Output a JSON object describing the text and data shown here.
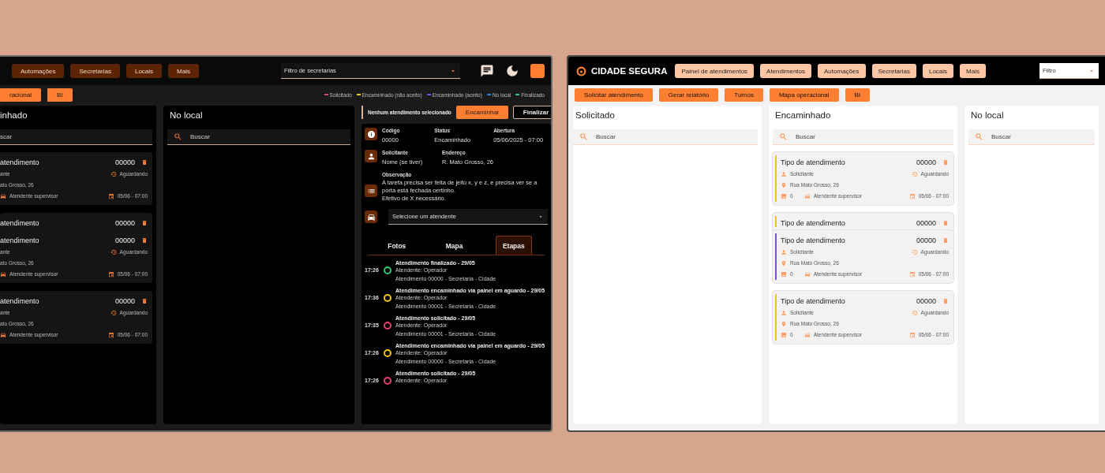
{
  "windows": [
    {
      "kind": "dark",
      "nav": [
        "Automações",
        "Secretarias",
        "Locais",
        "Mais"
      ],
      "filter": {
        "placeholder": "Filtro de secretarias"
      },
      "actions": [
        "racional",
        "BI"
      ],
      "legend": [
        {
          "label": "Solicitado",
          "color": "#e8436e"
        },
        {
          "label": "Encaminhado (não aceito)",
          "color": "#f5c518"
        },
        {
          "label": "Encaminhado (aceito)",
          "color": "#7b4cf0"
        },
        {
          "label": "No local",
          "color": "#1e88e5"
        },
        {
          "label": "Finalizado",
          "color": "#2ecc71"
        }
      ],
      "columns": [
        {
          "title": "inhado",
          "clipped": true,
          "search": {
            "placeholder": "scar"
          },
          "cards": [
            {
              "kind": "full",
              "title": "atendimento",
              "code": "00000",
              "requester": "ante",
              "status": "Aguardando",
              "address": "ato Grosso, 26",
              "attendant": "Atendente supervisor",
              "date": "05/06 - 07:00"
            },
            {
              "kind": "collapsed",
              "title": "atendimento",
              "code": "00000"
            },
            {
              "kind": "full",
              "title": "atendimento",
              "code": "00000",
              "requester": "ante",
              "status": "Aguardando",
              "address": "ato Grosso, 26",
              "attendant": "Atendente supervisor",
              "date": "05/06 - 07:00"
            },
            {
              "kind": "full",
              "title": "atendimento",
              "code": "00000",
              "requester": "ante",
              "status": "Aguardando",
              "address": "ato Grosso, 26",
              "attendant": "Atendente supervisor",
              "date": "05/06 - 07:00"
            }
          ]
        },
        {
          "title": "No local",
          "search": {
            "placeholder": "Buscar"
          }
        }
      ],
      "detail": {
        "notice": "Nenhum atendimento selecionado",
        "buttons": [
          {
            "label": "Encaminhar",
            "kind": "primary"
          },
          {
            "label": "Finalizar",
            "kind": "outline"
          }
        ],
        "summary": [
          {
            "label": "Código",
            "value": "00000"
          },
          {
            "label": "Status",
            "value": "Encaminhado"
          },
          {
            "label": "Abertura",
            "value": "05/06/2025 - 07:00"
          }
        ],
        "requester": [
          {
            "label": "Solicitante",
            "value": "Nome (se tiver)"
          },
          {
            "label": "Endereço",
            "value": "R. Mato Grosso, 26"
          }
        ],
        "observation": {
          "label": "Observação",
          "lines": [
            "A tarefa precisa ser feita de jeito x, y e z, e precisa ver se a porta está fechada certinho.",
            "Efetivo de X necessário."
          ]
        },
        "attendant_select": {
          "placeholder": "Selecione um atendente"
        },
        "tabs": [
          {
            "label": "Fotos",
            "selected": false
          },
          {
            "label": "Mapa",
            "selected": false
          },
          {
            "label": "Etapas",
            "selected": true
          }
        ],
        "timeline": [
          {
            "time": "17:26",
            "color": "#2ecc71",
            "title": "Atendimento finalizado - 29/05",
            "lines": [
              "Atendente: Operador",
              "Atendimento 00000 - Secretaria - Cidade"
            ]
          },
          {
            "time": "17:36",
            "color": "#f5c518",
            "title": "Atendimento encaminhado via painel em aguardo - 29/05",
            "lines": [
              "Atendente: Operador",
              "Atendimento 00001 - Secretaria - Cidade"
            ]
          },
          {
            "time": "17:35",
            "color": "#e8436e",
            "title": "Atendimento solicitado - 29/05",
            "lines": [
              "Atendente: Operador",
              "Atendimento 00001 - Secretaria - Cidade"
            ]
          },
          {
            "time": "17:26",
            "color": "#f5c518",
            "title": "Atendimento encaminhado via painel em aguardo - 29/05",
            "lines": [
              "Atendente: Operador",
              "Atendimento 00000 - Secretaria - Cidade"
            ]
          },
          {
            "time": "17:26",
            "color": "#e8436e",
            "title": "Atendimento solicitado - 29/05",
            "lines": [
              "Atendente: Operador"
            ]
          }
        ]
      }
    },
    {
      "kind": "light",
      "brand": "CIDADE SEGURA",
      "nav": [
        "Painel de atendimentos",
        "Atendimentos",
        "Automações",
        "Secretarias",
        "Locais",
        "Mais"
      ],
      "filter": {
        "placeholder": "Filtro"
      },
      "actions": [
        "Solicitar atendimento",
        "Gerar relatório",
        "Turnos",
        "Mapa operacional",
        "BI"
      ],
      "columns": [
        {
          "title": "Solicitado",
          "search": {
            "placeholder": "Buscar"
          }
        },
        {
          "title": "Encaminhado",
          "search": {
            "placeholder": "Buscar"
          },
          "cards": [
            {
              "kind": "full",
              "color": "#f5c518",
              "title": "Tipo de atendimento",
              "code": "00000",
              "requester": "Solicitante",
              "status": "Aguardando",
              "address": "Rua Mato Grosso, 26",
              "photos": "0",
              "attendant": "Atendente supervisor",
              "date": "05/06 - 07:00"
            },
            {
              "kind": "collapsed",
              "color": "#f5c518",
              "title": "Tipo de atendimento",
              "code": "00000"
            },
            {
              "kind": "full",
              "color": "#7b4cf0",
              "title": "Tipo de atendimento",
              "code": "00000",
              "requester": "Solicitante",
              "status": "Aguardando",
              "address": "Rua Mato Grosso, 26",
              "photos": "0",
              "attendant": "Atendente supervisor",
              "date": "05/06 - 07:00"
            },
            {
              "kind": "full",
              "color": "#f5c518",
              "title": "Tipo de atendimento",
              "code": "00000",
              "requester": "Solicitante",
              "status": "Aguardando",
              "address": "Rua Mato Grosso, 26",
              "photos": "0",
              "attendant": "Atendente supervisor",
              "date": "05/06 - 07:00"
            }
          ]
        },
        {
          "title": "No local",
          "search": {
            "placeholder": "Buscar"
          }
        }
      ]
    }
  ]
}
